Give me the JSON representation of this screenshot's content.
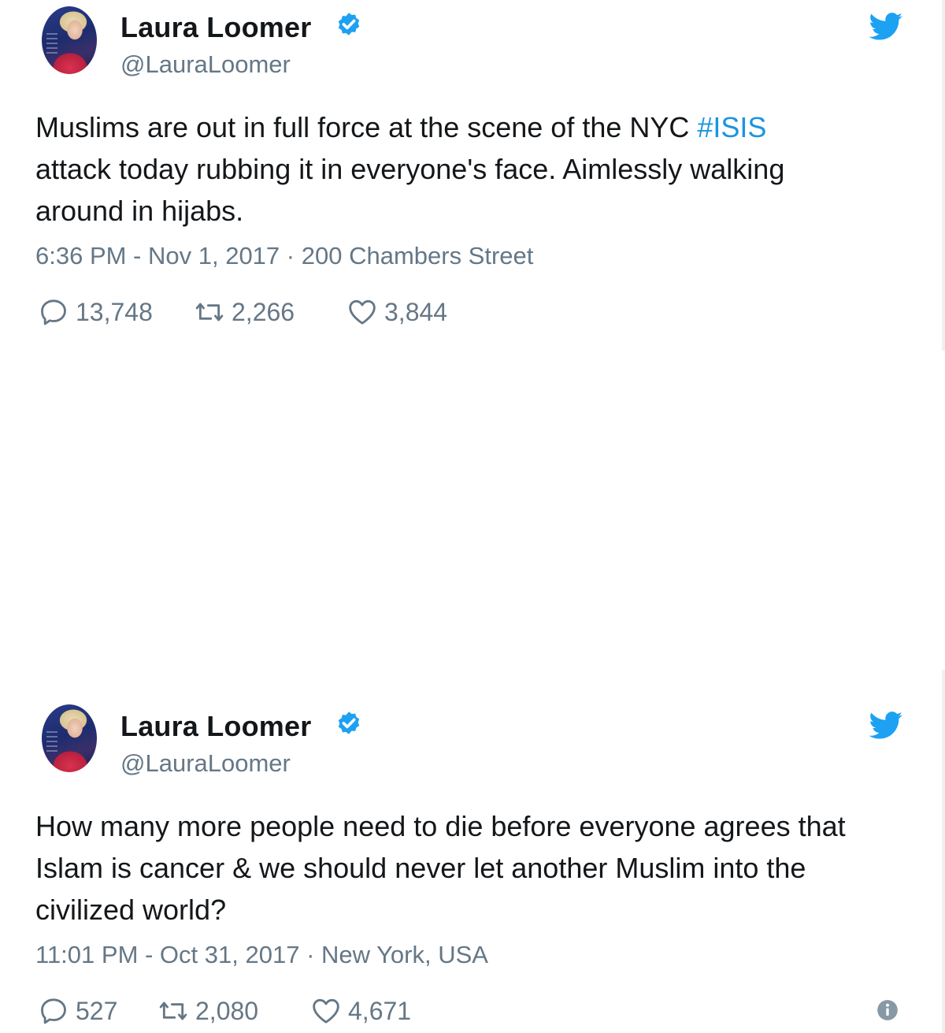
{
  "tweets": [
    {
      "name": "Laura Loomer",
      "handle": "@LauraLoomer",
      "text_lines": [
        [
          "Muslims are out in full force at the scene of the NYC ",
          "#ISIS"
        ],
        [
          "attack today rubbing it in everyone's face. Aimlessly walking",
          ""
        ],
        [
          "around in hijabs.",
          ""
        ]
      ],
      "timestamp": "6:36 PM - Nov 1, 2017",
      "location": "200 Chambers Street",
      "replies": "13,748",
      "retweets": "2,266",
      "likes": "3,844"
    },
    {
      "name": "Laura Loomer",
      "handle": "@LauraLoomer",
      "text_lines": [
        [
          "How many more people need to die before everyone agrees that",
          ""
        ],
        [
          "Islam is cancer & we should never let another Muslim into the",
          ""
        ],
        [
          "civilized world?",
          ""
        ]
      ],
      "timestamp": "11:01 PM - Oct 31, 2017",
      "location": "New York, USA",
      "replies": "527",
      "retweets": "2,080",
      "likes": "4,671"
    }
  ],
  "meta_separator": " · ",
  "colors": {
    "link": "#1b95e0",
    "twitter_blue": "#1da1f2",
    "muted": "#657786",
    "text": "#14171a"
  },
  "icons": [
    "verified-badge-icon",
    "twitter-bird-icon",
    "reply-icon",
    "retweet-icon",
    "like-heart-icon",
    "info-icon"
  ]
}
